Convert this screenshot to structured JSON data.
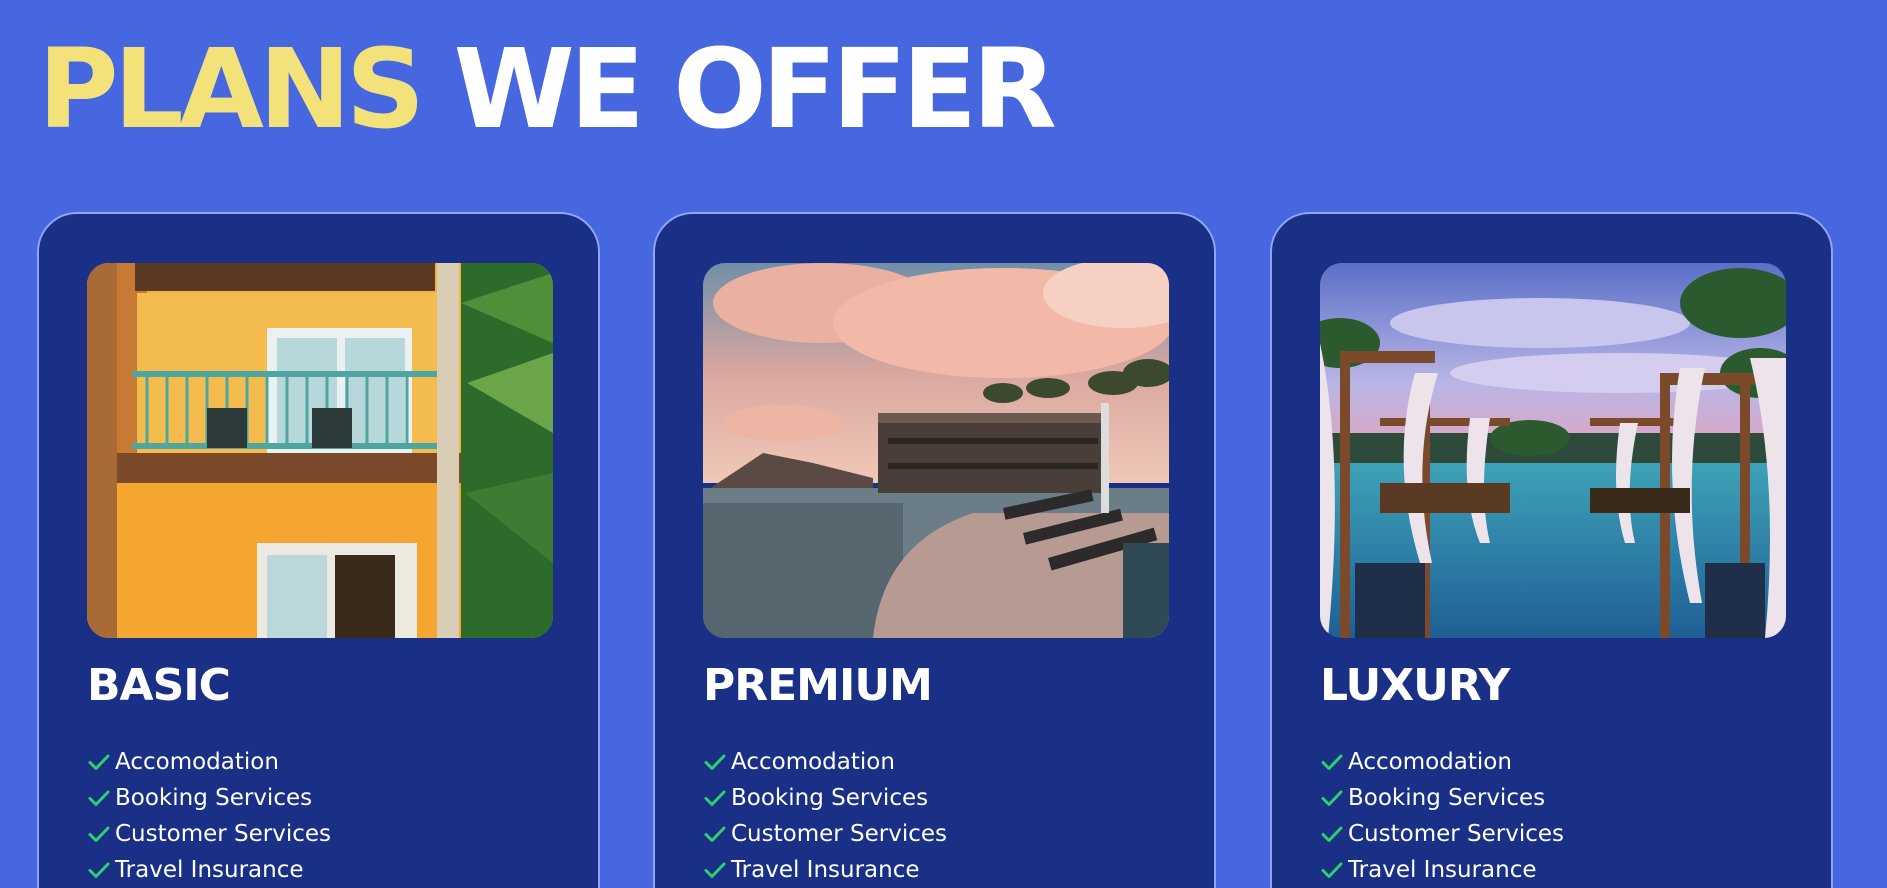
{
  "header": {
    "title_accent": "PLANS",
    "title_rest": "WE OFFER"
  },
  "colors": {
    "page_background": "#4667e0",
    "card_background": "#1a2f86",
    "card_border": "#8fa6f4",
    "title_accent": "#f3e27a",
    "check": "#2ed06e"
  },
  "plans": [
    {
      "name": "BASIC",
      "image": "hotel-balcony-photo",
      "features": [
        "Accomodation",
        "Booking Services",
        "Customer Services",
        "Travel Insurance"
      ]
    },
    {
      "name": "PREMIUM",
      "image": "seaside-resort-sunset-photo",
      "features": [
        "Accomodation",
        "Booking Services",
        "Customer Services",
        "Travel Insurance"
      ]
    },
    {
      "name": "LUXURY",
      "image": "luxury-pool-cabanas-photo",
      "features": [
        "Accomodation",
        "Booking Services",
        "Customer Services",
        "Travel Insurance"
      ]
    }
  ]
}
